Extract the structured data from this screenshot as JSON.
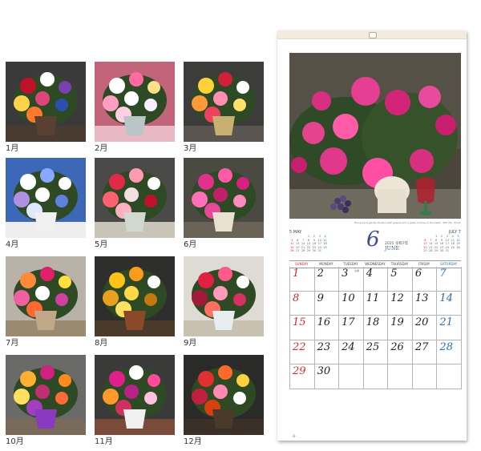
{
  "thumbnails": [
    {
      "label": "1月",
      "bg": "#3a3a3a",
      "table": "#4a3b30",
      "vase": "#5a4030",
      "blooms": [
        "#c0102a",
        "#ffffff",
        "#7a3fb0",
        "#ffd24a",
        "#e0457a",
        "#2a4fb0",
        "#ff7a2a"
      ]
    },
    {
      "label": "2月",
      "bg": "#c2647a",
      "table": "#e8b8c4",
      "vase": "#b9c6c8",
      "blooms": [
        "#ffffff",
        "#ff6aa0",
        "#ffe08a",
        "#ff9ec0",
        "#ffffff",
        "#f5f0ff",
        "#ffd0e0"
      ]
    },
    {
      "label": "3月",
      "bg": "#3c3c3a",
      "table": "#5a5550",
      "vase": "#c8b070",
      "blooms": [
        "#ffd23a",
        "#d0203a",
        "#ffffff",
        "#ff9a3a",
        "#ff8fb0",
        "#ffe06a",
        "#f04060"
      ]
    },
    {
      "label": "4月",
      "bg": "#3d68b8",
      "table": "#eeeeee",
      "vase": "#f0f0f0",
      "blooms": [
        "#ffffff",
        "#8aa8ff",
        "#ffffff",
        "#b090e0",
        "#ffffff",
        "#6080e0",
        "#e0e8ff"
      ]
    },
    {
      "label": "5月",
      "bg": "#4a4a48",
      "table": "#c8c4b8",
      "vase": "#d0d8d0",
      "blooms": [
        "#e02a4a",
        "#ff9ab0",
        "#ffffff",
        "#ff6070",
        "#f0e0e0",
        "#c01030",
        "#ffb0c0"
      ]
    },
    {
      "label": "6月",
      "bg": "#4a4a42",
      "table": "#6a6458",
      "vase": "#e8e0d0",
      "blooms": [
        "#e0308a",
        "#ff5aa8",
        "#d82080",
        "#ff70b8",
        "#c0206a",
        "#ff8ac0",
        "#e84898"
      ]
    },
    {
      "label": "7月",
      "bg": "#b8b2a8",
      "table": "#9a8a70",
      "vase": "#c0a888",
      "blooms": [
        "#ff8a3a",
        "#e0206a",
        "#ffe040",
        "#f060a0",
        "#ffffff",
        "#d040a0",
        "#ff6a30"
      ]
    },
    {
      "label": "8月",
      "bg": "#2e2e2c",
      "table": "#4a3a2a",
      "vase": "#8a4a2a",
      "blooms": [
        "#ffc21a",
        "#ff9a1a",
        "#ffffff",
        "#e8a020",
        "#ffd84a",
        "#c07a10",
        "#ffe060"
      ]
    },
    {
      "label": "9月",
      "bg": "#dedbd4",
      "table": "#c8c0b0",
      "vase": "#e8eef0",
      "blooms": [
        "#e02040",
        "#ff5a8a",
        "#ffffff",
        "#a01a3a",
        "#ff9ab8",
        "#d83060",
        "#ff7060"
      ]
    },
    {
      "label": "10月",
      "bg": "#6a6a68",
      "table": "#7a6a5a",
      "vase": "#8a3ac0",
      "blooms": [
        "#ffb030",
        "#d02080",
        "#ff8a20",
        "#ffe060",
        "#c03070",
        "#ff6a3a",
        "#a040c0"
      ]
    },
    {
      "label": "11月",
      "bg": "#3a3a38",
      "table": "#7a4a3a",
      "vase": "#f0f0f0",
      "blooms": [
        "#e0208a",
        "#ffffff",
        "#ff4a9a",
        "#ff9a2a",
        "#b8208a",
        "#ffc0e0",
        "#d03060"
      ]
    },
    {
      "label": "12月",
      "bg": "#2a2a28",
      "table": "#3a3028",
      "vase": "#4a3a2a",
      "blooms": [
        "#e03030",
        "#ff6a2a",
        "#ffd040",
        "#c02040",
        "#ff8ab0",
        "#ffffff",
        "#d84010"
      ]
    }
  ],
  "calendar": {
    "photo_credit": "Bouquet of garden flowers with grapes and a glass of wine on the table · Still life · Photo",
    "month_number": "6",
    "year": "2025",
    "year_suffix": "令和7年",
    "month_name": "JUNE",
    "prev_month": {
      "title": "5 MAY",
      "days": [
        "",
        "",
        "",
        "1",
        "2",
        "3",
        "4",
        "5",
        "6",
        "7",
        "8",
        "9",
        "10",
        "11",
        "12",
        "13",
        "14",
        "15",
        "16",
        "17",
        "18",
        "19",
        "20",
        "21",
        "22",
        "23",
        "24",
        "25",
        "26",
        "27",
        "28",
        "29",
        "30",
        "31"
      ]
    },
    "next_month": {
      "title": "JULY 7",
      "days": [
        "",
        "",
        "1",
        "2",
        "3",
        "4",
        "5",
        "6",
        "7",
        "8",
        "9",
        "10",
        "11",
        "12",
        "13",
        "14",
        "15",
        "16",
        "17",
        "18",
        "19",
        "20",
        "21",
        "22",
        "23",
        "24",
        "25",
        "26",
        "27",
        "28",
        "29",
        "30",
        "31"
      ]
    },
    "weekdays": [
      "SUNDAY",
      "MONDAY",
      "TUESDAY",
      "WEDNESDAY",
      "THURSDAY",
      "FRIDAY",
      "SATURDAY"
    ],
    "weekday_colors": [
      "#d42a2a",
      "#444444",
      "#444444",
      "#444444",
      "#444444",
      "#444444",
      "#2a6fb0"
    ],
    "days": [
      "1",
      "2",
      "3",
      "4",
      "5",
      "6",
      "7",
      "8",
      "9",
      "10",
      "11",
      "12",
      "13",
      "14",
      "15",
      "16",
      "17",
      "18",
      "19",
      "20",
      "21",
      "22",
      "23",
      "24",
      "25",
      "26",
      "27",
      "28",
      "29",
      "30"
    ],
    "day_sup": [
      "",
      "",
      "先勝",
      "",
      "",
      "",
      "",
      "",
      "",
      "",
      "",
      "",
      "",
      "",
      "",
      "",
      "",
      "",
      "",
      "",
      "",
      "",
      "",
      "",
      "",
      "",
      "",
      "",
      "",
      ""
    ],
    "page_number": "-6-"
  }
}
